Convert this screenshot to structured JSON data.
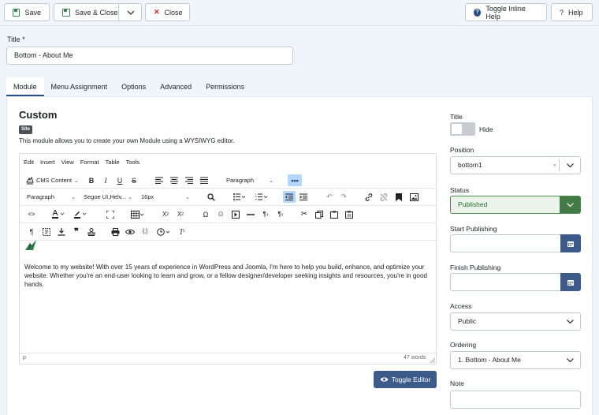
{
  "toolbar": {
    "save": "Save",
    "save_close": "Save & Close",
    "close": "Close",
    "toggle_inline_help": "Toggle Inline Help",
    "help": "Help"
  },
  "title_field": {
    "label": "Title *",
    "value": "Bottom - About Me"
  },
  "tabs": [
    "Module",
    "Menu Assignment",
    "Options",
    "Advanced",
    "Permissions"
  ],
  "module": {
    "heading": "Custom",
    "badge": "Site",
    "description": "This module allows you to create your own Module using a WYSIWYG editor."
  },
  "editor": {
    "menu": [
      "Edit",
      "Insert",
      "View",
      "Format",
      "Table",
      "Tools"
    ],
    "cms_content": "CMS Content",
    "block_format_top": "Paragraph",
    "block_format": "Paragraph",
    "font_family": "Segoe UI,Helv...",
    "font_size": "16px",
    "content": "Welcome to my website! With over 15 years of experience in WordPress and Joomla, I'm here to help you build, enhance, and optimize your website. Whether you're an end-user looking to learn and grow, or a fellow designer/developer seeking insights and resources, you're in good hands.",
    "status_path": "p",
    "word_count": "47 words",
    "toggle_editor": "Toggle Editor"
  },
  "sidebar": {
    "title_label": "Title",
    "hide_label": "Hide",
    "position_label": "Position",
    "position_value": "bottom1",
    "status_label": "Status",
    "status_value": "Published",
    "start_label": "Start Publishing",
    "finish_label": "Finish Publishing",
    "access_label": "Access",
    "access_value": "Public",
    "ordering_label": "Ordering",
    "ordering_value": "1. Bottom - About Me",
    "note_label": "Note"
  },
  "colors": {
    "primary": "#3c5a8a",
    "success": "#437a46",
    "danger": "#c52827"
  }
}
